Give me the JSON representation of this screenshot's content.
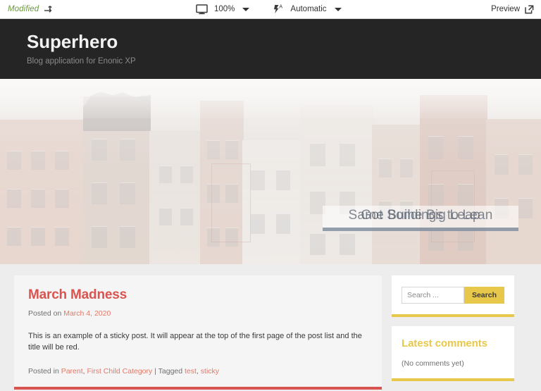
{
  "toolbar": {
    "status_label": "Modified",
    "revert_icon": "revert-arrow-icon",
    "device_icon": "desktop-monitor-icon",
    "zoom_value": "100%",
    "flash_icon": "flash-auto-icon",
    "render_mode": "Automatic",
    "preview_label": "Preview",
    "external_link_icon": "external-link-icon"
  },
  "site_header": {
    "title": "Superhero",
    "tagline": "Blog application for Enonic XP"
  },
  "hero": {
    "caption_slide_a": "Got Some Big Leap",
    "caption_slide_b": "Same Buildings to Lean"
  },
  "post": {
    "title": "March Madness",
    "posted_on_prefix": "Posted on ",
    "date": "March 4, 2020",
    "body": "This is an example of a sticky post. It will appear at the top of the first page of the post list and the title will be red.",
    "posted_in_prefix": "Posted in ",
    "category_1": "Parent",
    "category_sep": ", ",
    "category_2": "First Child Category",
    "tagged_prefix": " | Tagged ",
    "tag_1": "test",
    "tag_sep": ", ",
    "tag_2": "sticky"
  },
  "sidebar": {
    "search": {
      "placeholder": "Search ...",
      "value": "",
      "button_label": "Search"
    },
    "latest_comments": {
      "title": "Latest comments",
      "empty_text": "(No comments yet)"
    }
  },
  "colors": {
    "accent_red": "#d9544e",
    "accent_yellow": "#e8c84a",
    "header_dark": "#252525",
    "modified_green": "#6a9a3c"
  }
}
